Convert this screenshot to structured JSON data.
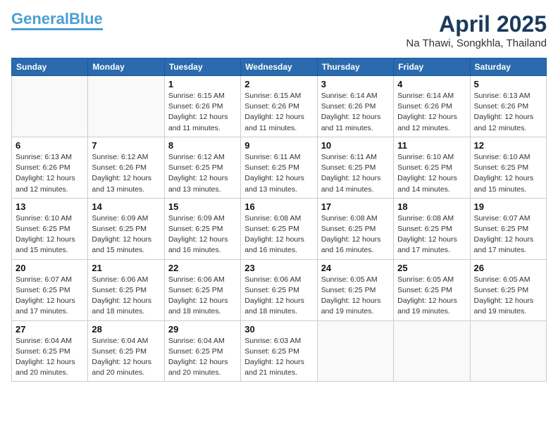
{
  "logo": {
    "general": "General",
    "blue": "Blue"
  },
  "header": {
    "month_year": "April 2025",
    "location": "Na Thawi, Songkhla, Thailand"
  },
  "weekdays": [
    "Sunday",
    "Monday",
    "Tuesday",
    "Wednesday",
    "Thursday",
    "Friday",
    "Saturday"
  ],
  "weeks": [
    [
      {
        "day": "",
        "info": ""
      },
      {
        "day": "",
        "info": ""
      },
      {
        "day": "1",
        "info": "Sunrise: 6:15 AM\nSunset: 6:26 PM\nDaylight: 12 hours\nand 11 minutes."
      },
      {
        "day": "2",
        "info": "Sunrise: 6:15 AM\nSunset: 6:26 PM\nDaylight: 12 hours\nand 11 minutes."
      },
      {
        "day": "3",
        "info": "Sunrise: 6:14 AM\nSunset: 6:26 PM\nDaylight: 12 hours\nand 11 minutes."
      },
      {
        "day": "4",
        "info": "Sunrise: 6:14 AM\nSunset: 6:26 PM\nDaylight: 12 hours\nand 12 minutes."
      },
      {
        "day": "5",
        "info": "Sunrise: 6:13 AM\nSunset: 6:26 PM\nDaylight: 12 hours\nand 12 minutes."
      }
    ],
    [
      {
        "day": "6",
        "info": "Sunrise: 6:13 AM\nSunset: 6:26 PM\nDaylight: 12 hours\nand 12 minutes."
      },
      {
        "day": "7",
        "info": "Sunrise: 6:12 AM\nSunset: 6:26 PM\nDaylight: 12 hours\nand 13 minutes."
      },
      {
        "day": "8",
        "info": "Sunrise: 6:12 AM\nSunset: 6:25 PM\nDaylight: 12 hours\nand 13 minutes."
      },
      {
        "day": "9",
        "info": "Sunrise: 6:11 AM\nSunset: 6:25 PM\nDaylight: 12 hours\nand 13 minutes."
      },
      {
        "day": "10",
        "info": "Sunrise: 6:11 AM\nSunset: 6:25 PM\nDaylight: 12 hours\nand 14 minutes."
      },
      {
        "day": "11",
        "info": "Sunrise: 6:10 AM\nSunset: 6:25 PM\nDaylight: 12 hours\nand 14 minutes."
      },
      {
        "day": "12",
        "info": "Sunrise: 6:10 AM\nSunset: 6:25 PM\nDaylight: 12 hours\nand 15 minutes."
      }
    ],
    [
      {
        "day": "13",
        "info": "Sunrise: 6:10 AM\nSunset: 6:25 PM\nDaylight: 12 hours\nand 15 minutes."
      },
      {
        "day": "14",
        "info": "Sunrise: 6:09 AM\nSunset: 6:25 PM\nDaylight: 12 hours\nand 15 minutes."
      },
      {
        "day": "15",
        "info": "Sunrise: 6:09 AM\nSunset: 6:25 PM\nDaylight: 12 hours\nand 16 minutes."
      },
      {
        "day": "16",
        "info": "Sunrise: 6:08 AM\nSunset: 6:25 PM\nDaylight: 12 hours\nand 16 minutes."
      },
      {
        "day": "17",
        "info": "Sunrise: 6:08 AM\nSunset: 6:25 PM\nDaylight: 12 hours\nand 16 minutes."
      },
      {
        "day": "18",
        "info": "Sunrise: 6:08 AM\nSunset: 6:25 PM\nDaylight: 12 hours\nand 17 minutes."
      },
      {
        "day": "19",
        "info": "Sunrise: 6:07 AM\nSunset: 6:25 PM\nDaylight: 12 hours\nand 17 minutes."
      }
    ],
    [
      {
        "day": "20",
        "info": "Sunrise: 6:07 AM\nSunset: 6:25 PM\nDaylight: 12 hours\nand 17 minutes."
      },
      {
        "day": "21",
        "info": "Sunrise: 6:06 AM\nSunset: 6:25 PM\nDaylight: 12 hours\nand 18 minutes."
      },
      {
        "day": "22",
        "info": "Sunrise: 6:06 AM\nSunset: 6:25 PM\nDaylight: 12 hours\nand 18 minutes."
      },
      {
        "day": "23",
        "info": "Sunrise: 6:06 AM\nSunset: 6:25 PM\nDaylight: 12 hours\nand 18 minutes."
      },
      {
        "day": "24",
        "info": "Sunrise: 6:05 AM\nSunset: 6:25 PM\nDaylight: 12 hours\nand 19 minutes."
      },
      {
        "day": "25",
        "info": "Sunrise: 6:05 AM\nSunset: 6:25 PM\nDaylight: 12 hours\nand 19 minutes."
      },
      {
        "day": "26",
        "info": "Sunrise: 6:05 AM\nSunset: 6:25 PM\nDaylight: 12 hours\nand 19 minutes."
      }
    ],
    [
      {
        "day": "27",
        "info": "Sunrise: 6:04 AM\nSunset: 6:25 PM\nDaylight: 12 hours\nand 20 minutes."
      },
      {
        "day": "28",
        "info": "Sunrise: 6:04 AM\nSunset: 6:25 PM\nDaylight: 12 hours\nand 20 minutes."
      },
      {
        "day": "29",
        "info": "Sunrise: 6:04 AM\nSunset: 6:25 PM\nDaylight: 12 hours\nand 20 minutes."
      },
      {
        "day": "30",
        "info": "Sunrise: 6:03 AM\nSunset: 6:25 PM\nDaylight: 12 hours\nand 21 minutes."
      },
      {
        "day": "",
        "info": ""
      },
      {
        "day": "",
        "info": ""
      },
      {
        "day": "",
        "info": ""
      }
    ]
  ]
}
